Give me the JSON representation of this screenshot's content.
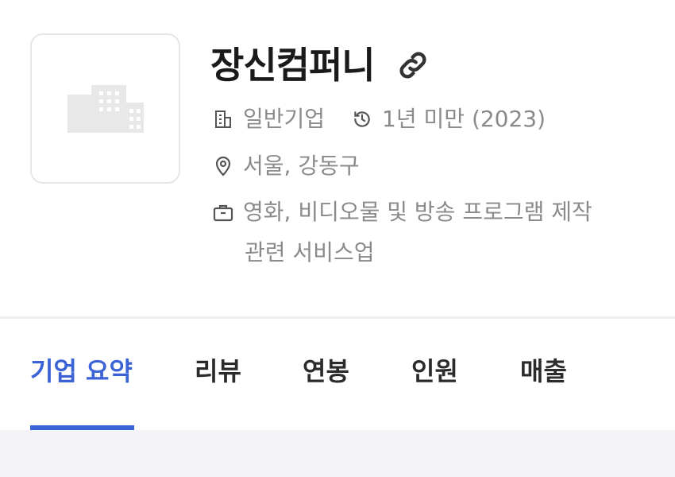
{
  "company": {
    "name": "장신컴퍼니",
    "type": "일반기업",
    "age": "1년 미만 (2023)",
    "location": "서울, 강동구",
    "industry_line1": "영화, 비디오물 및 방송 프로그램 제작",
    "industry_line2": "관련 서비스업"
  },
  "icons": {
    "logo": "building-placeholder-icon",
    "link": "link-icon",
    "type": "building-icon",
    "age": "clock-history-icon",
    "location": "map-pin-icon",
    "industry": "briefcase-icon"
  },
  "tabs": [
    {
      "label": "기업 요약",
      "active": true
    },
    {
      "label": "리뷰",
      "active": false
    },
    {
      "label": "연봉",
      "active": false
    },
    {
      "label": "인원",
      "active": false
    },
    {
      "label": "매출",
      "active": false
    }
  ],
  "colors": {
    "accent": "#3b63d6",
    "text_primary": "#1a1a1a",
    "text_secondary": "#8a8a8a"
  }
}
